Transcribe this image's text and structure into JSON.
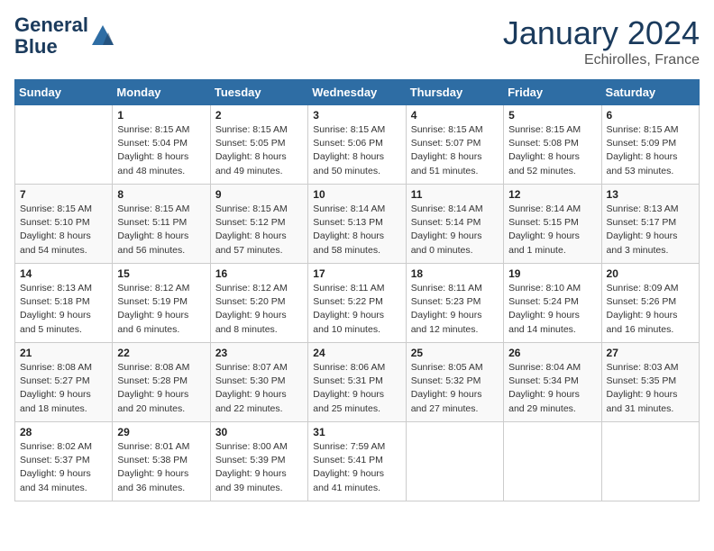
{
  "header": {
    "logo_line1": "General",
    "logo_line2": "Blue",
    "month": "January 2024",
    "location": "Echirolles, France"
  },
  "weekdays": [
    "Sunday",
    "Monday",
    "Tuesday",
    "Wednesday",
    "Thursday",
    "Friday",
    "Saturday"
  ],
  "weeks": [
    [
      {
        "day": "",
        "sunrise": "",
        "sunset": "",
        "daylight": ""
      },
      {
        "day": "1",
        "sunrise": "Sunrise: 8:15 AM",
        "sunset": "Sunset: 5:04 PM",
        "daylight": "Daylight: 8 hours and 48 minutes."
      },
      {
        "day": "2",
        "sunrise": "Sunrise: 8:15 AM",
        "sunset": "Sunset: 5:05 PM",
        "daylight": "Daylight: 8 hours and 49 minutes."
      },
      {
        "day": "3",
        "sunrise": "Sunrise: 8:15 AM",
        "sunset": "Sunset: 5:06 PM",
        "daylight": "Daylight: 8 hours and 50 minutes."
      },
      {
        "day": "4",
        "sunrise": "Sunrise: 8:15 AM",
        "sunset": "Sunset: 5:07 PM",
        "daylight": "Daylight: 8 hours and 51 minutes."
      },
      {
        "day": "5",
        "sunrise": "Sunrise: 8:15 AM",
        "sunset": "Sunset: 5:08 PM",
        "daylight": "Daylight: 8 hours and 52 minutes."
      },
      {
        "day": "6",
        "sunrise": "Sunrise: 8:15 AM",
        "sunset": "Sunset: 5:09 PM",
        "daylight": "Daylight: 8 hours and 53 minutes."
      }
    ],
    [
      {
        "day": "7",
        "sunrise": "Sunrise: 8:15 AM",
        "sunset": "Sunset: 5:10 PM",
        "daylight": "Daylight: 8 hours and 54 minutes."
      },
      {
        "day": "8",
        "sunrise": "Sunrise: 8:15 AM",
        "sunset": "Sunset: 5:11 PM",
        "daylight": "Daylight: 8 hours and 56 minutes."
      },
      {
        "day": "9",
        "sunrise": "Sunrise: 8:15 AM",
        "sunset": "Sunset: 5:12 PM",
        "daylight": "Daylight: 8 hours and 57 minutes."
      },
      {
        "day": "10",
        "sunrise": "Sunrise: 8:14 AM",
        "sunset": "Sunset: 5:13 PM",
        "daylight": "Daylight: 8 hours and 58 minutes."
      },
      {
        "day": "11",
        "sunrise": "Sunrise: 8:14 AM",
        "sunset": "Sunset: 5:14 PM",
        "daylight": "Daylight: 9 hours and 0 minutes."
      },
      {
        "day": "12",
        "sunrise": "Sunrise: 8:14 AM",
        "sunset": "Sunset: 5:15 PM",
        "daylight": "Daylight: 9 hours and 1 minute."
      },
      {
        "day": "13",
        "sunrise": "Sunrise: 8:13 AM",
        "sunset": "Sunset: 5:17 PM",
        "daylight": "Daylight: 9 hours and 3 minutes."
      }
    ],
    [
      {
        "day": "14",
        "sunrise": "Sunrise: 8:13 AM",
        "sunset": "Sunset: 5:18 PM",
        "daylight": "Daylight: 9 hours and 5 minutes."
      },
      {
        "day": "15",
        "sunrise": "Sunrise: 8:12 AM",
        "sunset": "Sunset: 5:19 PM",
        "daylight": "Daylight: 9 hours and 6 minutes."
      },
      {
        "day": "16",
        "sunrise": "Sunrise: 8:12 AM",
        "sunset": "Sunset: 5:20 PM",
        "daylight": "Daylight: 9 hours and 8 minutes."
      },
      {
        "day": "17",
        "sunrise": "Sunrise: 8:11 AM",
        "sunset": "Sunset: 5:22 PM",
        "daylight": "Daylight: 9 hours and 10 minutes."
      },
      {
        "day": "18",
        "sunrise": "Sunrise: 8:11 AM",
        "sunset": "Sunset: 5:23 PM",
        "daylight": "Daylight: 9 hours and 12 minutes."
      },
      {
        "day": "19",
        "sunrise": "Sunrise: 8:10 AM",
        "sunset": "Sunset: 5:24 PM",
        "daylight": "Daylight: 9 hours and 14 minutes."
      },
      {
        "day": "20",
        "sunrise": "Sunrise: 8:09 AM",
        "sunset": "Sunset: 5:26 PM",
        "daylight": "Daylight: 9 hours and 16 minutes."
      }
    ],
    [
      {
        "day": "21",
        "sunrise": "Sunrise: 8:08 AM",
        "sunset": "Sunset: 5:27 PM",
        "daylight": "Daylight: 9 hours and 18 minutes."
      },
      {
        "day": "22",
        "sunrise": "Sunrise: 8:08 AM",
        "sunset": "Sunset: 5:28 PM",
        "daylight": "Daylight: 9 hours and 20 minutes."
      },
      {
        "day": "23",
        "sunrise": "Sunrise: 8:07 AM",
        "sunset": "Sunset: 5:30 PM",
        "daylight": "Daylight: 9 hours and 22 minutes."
      },
      {
        "day": "24",
        "sunrise": "Sunrise: 8:06 AM",
        "sunset": "Sunset: 5:31 PM",
        "daylight": "Daylight: 9 hours and 25 minutes."
      },
      {
        "day": "25",
        "sunrise": "Sunrise: 8:05 AM",
        "sunset": "Sunset: 5:32 PM",
        "daylight": "Daylight: 9 hours and 27 minutes."
      },
      {
        "day": "26",
        "sunrise": "Sunrise: 8:04 AM",
        "sunset": "Sunset: 5:34 PM",
        "daylight": "Daylight: 9 hours and 29 minutes."
      },
      {
        "day": "27",
        "sunrise": "Sunrise: 8:03 AM",
        "sunset": "Sunset: 5:35 PM",
        "daylight": "Daylight: 9 hours and 31 minutes."
      }
    ],
    [
      {
        "day": "28",
        "sunrise": "Sunrise: 8:02 AM",
        "sunset": "Sunset: 5:37 PM",
        "daylight": "Daylight: 9 hours and 34 minutes."
      },
      {
        "day": "29",
        "sunrise": "Sunrise: 8:01 AM",
        "sunset": "Sunset: 5:38 PM",
        "daylight": "Daylight: 9 hours and 36 minutes."
      },
      {
        "day": "30",
        "sunrise": "Sunrise: 8:00 AM",
        "sunset": "Sunset: 5:39 PM",
        "daylight": "Daylight: 9 hours and 39 minutes."
      },
      {
        "day": "31",
        "sunrise": "Sunrise: 7:59 AM",
        "sunset": "Sunset: 5:41 PM",
        "daylight": "Daylight: 9 hours and 41 minutes."
      },
      {
        "day": "",
        "sunrise": "",
        "sunset": "",
        "daylight": ""
      },
      {
        "day": "",
        "sunrise": "",
        "sunset": "",
        "daylight": ""
      },
      {
        "day": "",
        "sunrise": "",
        "sunset": "",
        "daylight": ""
      }
    ]
  ]
}
